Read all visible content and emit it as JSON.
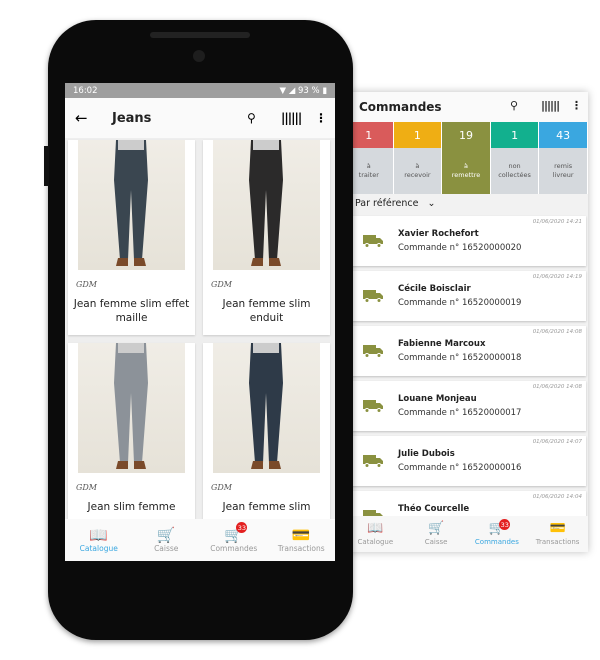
{
  "orders_screen": {
    "title": "Commandes",
    "icons": [
      "search-icon",
      "barcode-icon",
      "more-vertical-icon"
    ],
    "stats": [
      {
        "count": "1",
        "label1": "à",
        "label2": "traiter",
        "color": "#d95b5b"
      },
      {
        "count": "1",
        "label1": "à",
        "label2": "recevoir",
        "color": "#efae14"
      },
      {
        "count": "19",
        "label1": "à",
        "label2": "remettre",
        "color": "#8a9140"
      },
      {
        "count": "1",
        "label1": "non",
        "label2": "collectées",
        "color": "#12b08e"
      },
      {
        "count": "43",
        "label1": "remis",
        "label2": "livreur",
        "color": "#3aa7e0"
      }
    ],
    "sort_label": "Par référence",
    "orders": [
      {
        "date": "01/06/2020 14:21",
        "name": "Xavier Rochefort",
        "order": "Commande n°  16520000020"
      },
      {
        "date": "01/06/2020 14:19",
        "name": "Cécile Boisclair",
        "order": "Commande n°  16520000019"
      },
      {
        "date": "01/06/2020 14:08",
        "name": "Fabienne Marcoux",
        "order": "Commande n°  16520000018"
      },
      {
        "date": "01/06/2020 14:08",
        "name": "Louane Monjeau",
        "order": "Commande n°  16520000017"
      },
      {
        "date": "01/06/2020 14:07",
        "name": "Julie Dubois",
        "order": "Commande n°  16520000016"
      },
      {
        "date": "01/06/2020 14:04",
        "name": "Théo Courcelle",
        "order": ""
      }
    ],
    "nav": [
      {
        "label": "Catalogue"
      },
      {
        "label": "Caisse"
      },
      {
        "label": "Commandes",
        "badge": "33",
        "active": true
      },
      {
        "label": "Transactions"
      }
    ]
  },
  "catalog_screen": {
    "status": {
      "time": "16:02",
      "battery": "93 %"
    },
    "title": "Jeans",
    "products": [
      {
        "brand": "GDM",
        "name": "Jean femme slim effet maille",
        "color": "#3a4650"
      },
      {
        "brand": "GDM",
        "name": "Jean femme slim enduit",
        "color": "#2b2a2a"
      },
      {
        "brand": "GDM",
        "name": "Jean slim femme",
        "color": "#8c9299"
      },
      {
        "brand": "GDM",
        "name": "Jean femme slim",
        "color": "#2e3a48"
      }
    ],
    "nav": [
      {
        "label": "Catalogue",
        "active": true
      },
      {
        "label": "Caisse"
      },
      {
        "label": "Commandes",
        "badge": "33"
      },
      {
        "label": "Transactions"
      }
    ]
  },
  "accent": "#3aa7e0"
}
